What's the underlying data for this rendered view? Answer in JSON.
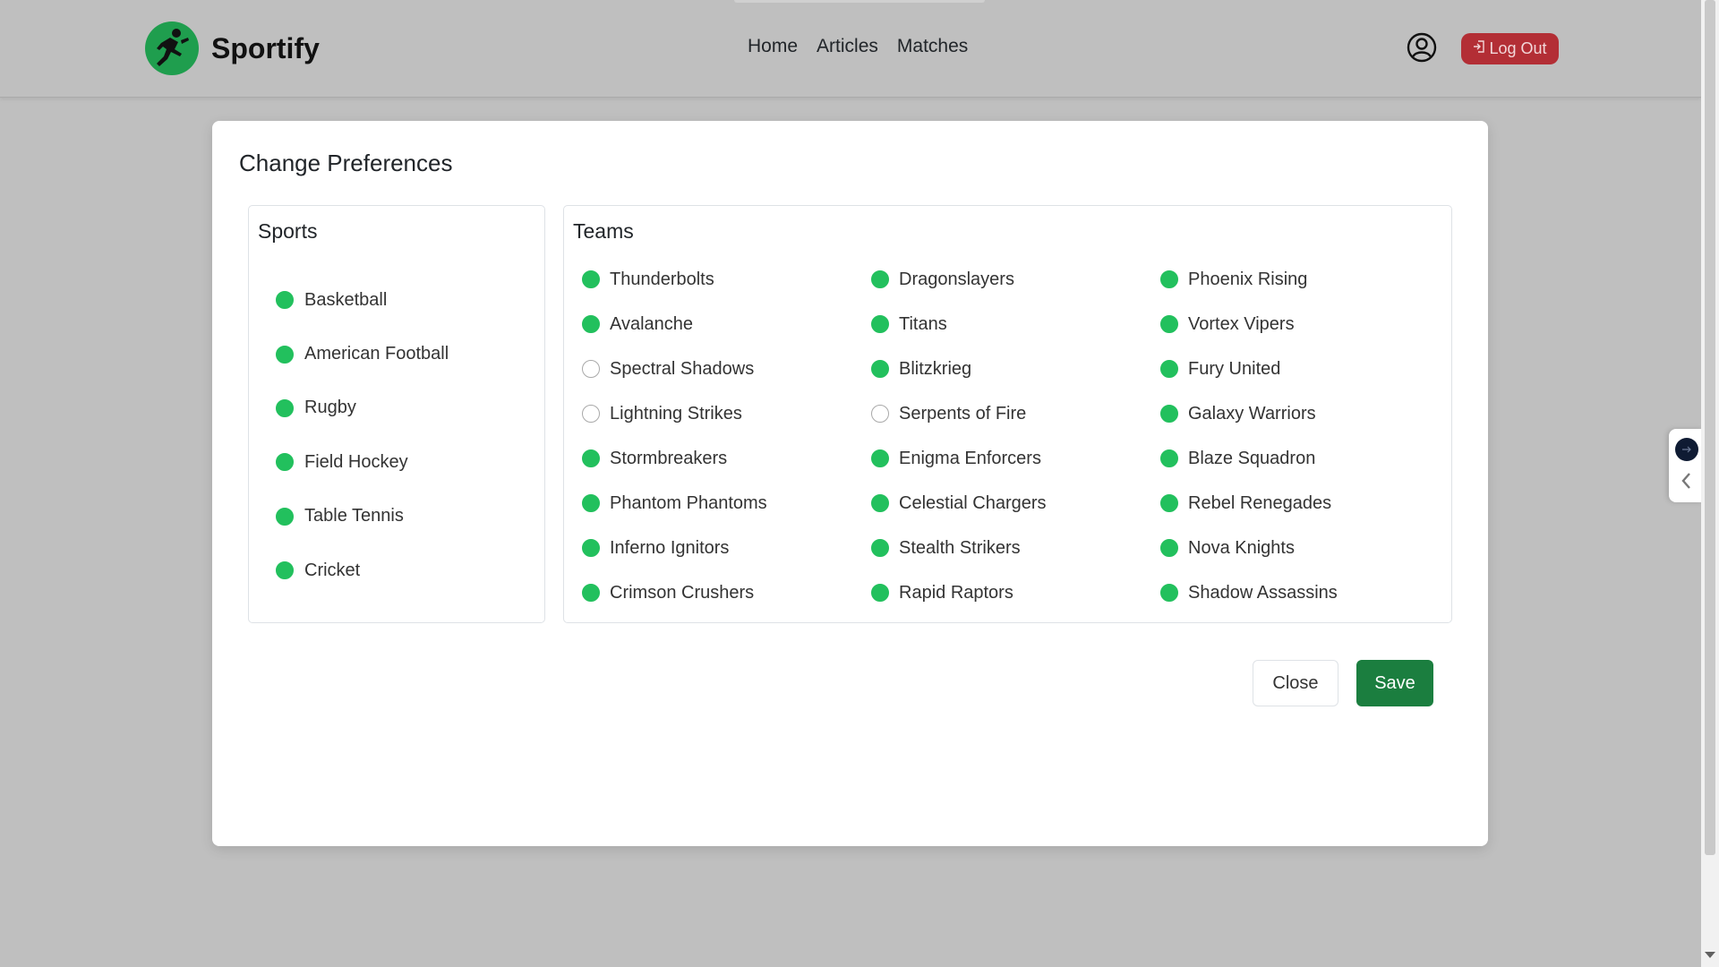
{
  "app": {
    "brand_name": "Sportify",
    "nav": [
      {
        "label": "Home"
      },
      {
        "label": "Articles"
      },
      {
        "label": "Matches"
      }
    ],
    "logout_label": "Log Out",
    "colors": {
      "brand": "#1f9e4e",
      "danger": "#b32e35",
      "checked": "#22c05d",
      "save": "#1b7e3f"
    }
  },
  "modal": {
    "title": "Change Preferences",
    "sports": {
      "heading": "Sports",
      "items": [
        {
          "label": "Basketball",
          "checked": true
        },
        {
          "label": "American Football",
          "checked": true
        },
        {
          "label": "Rugby",
          "checked": true
        },
        {
          "label": "Field Hockey",
          "checked": true
        },
        {
          "label": "Table Tennis",
          "checked": true
        },
        {
          "label": "Cricket",
          "checked": true
        }
      ]
    },
    "teams": {
      "heading": "Teams",
      "items": [
        {
          "label": "Thunderbolts",
          "checked": true
        },
        {
          "label": "Dragonslayers",
          "checked": true
        },
        {
          "label": "Phoenix Rising",
          "checked": true
        },
        {
          "label": "Avalanche",
          "checked": true
        },
        {
          "label": "Titans",
          "checked": true
        },
        {
          "label": "Vortex Vipers",
          "checked": true
        },
        {
          "label": "Spectral Shadows",
          "checked": false
        },
        {
          "label": "Blitzkrieg",
          "checked": true
        },
        {
          "label": "Fury United",
          "checked": true
        },
        {
          "label": "Lightning Strikes",
          "checked": false
        },
        {
          "label": "Serpents of Fire",
          "checked": false
        },
        {
          "label": "Galaxy Warriors",
          "checked": true
        },
        {
          "label": "Stormbreakers",
          "checked": true
        },
        {
          "label": "Enigma Enforcers",
          "checked": true
        },
        {
          "label": "Blaze Squadron",
          "checked": true
        },
        {
          "label": "Phantom Phantoms",
          "checked": true
        },
        {
          "label": "Celestial Chargers",
          "checked": true
        },
        {
          "label": "Rebel Renegades",
          "checked": true
        },
        {
          "label": "Inferno Ignitors",
          "checked": true
        },
        {
          "label": "Stealth Strikers",
          "checked": true
        },
        {
          "label": "Nova Knights",
          "checked": true
        },
        {
          "label": "Crimson Crushers",
          "checked": true
        },
        {
          "label": "Rapid Raptors",
          "checked": true
        },
        {
          "label": "Shadow Assassins",
          "checked": true
        }
      ]
    },
    "close_label": "Close",
    "save_label": "Save"
  }
}
